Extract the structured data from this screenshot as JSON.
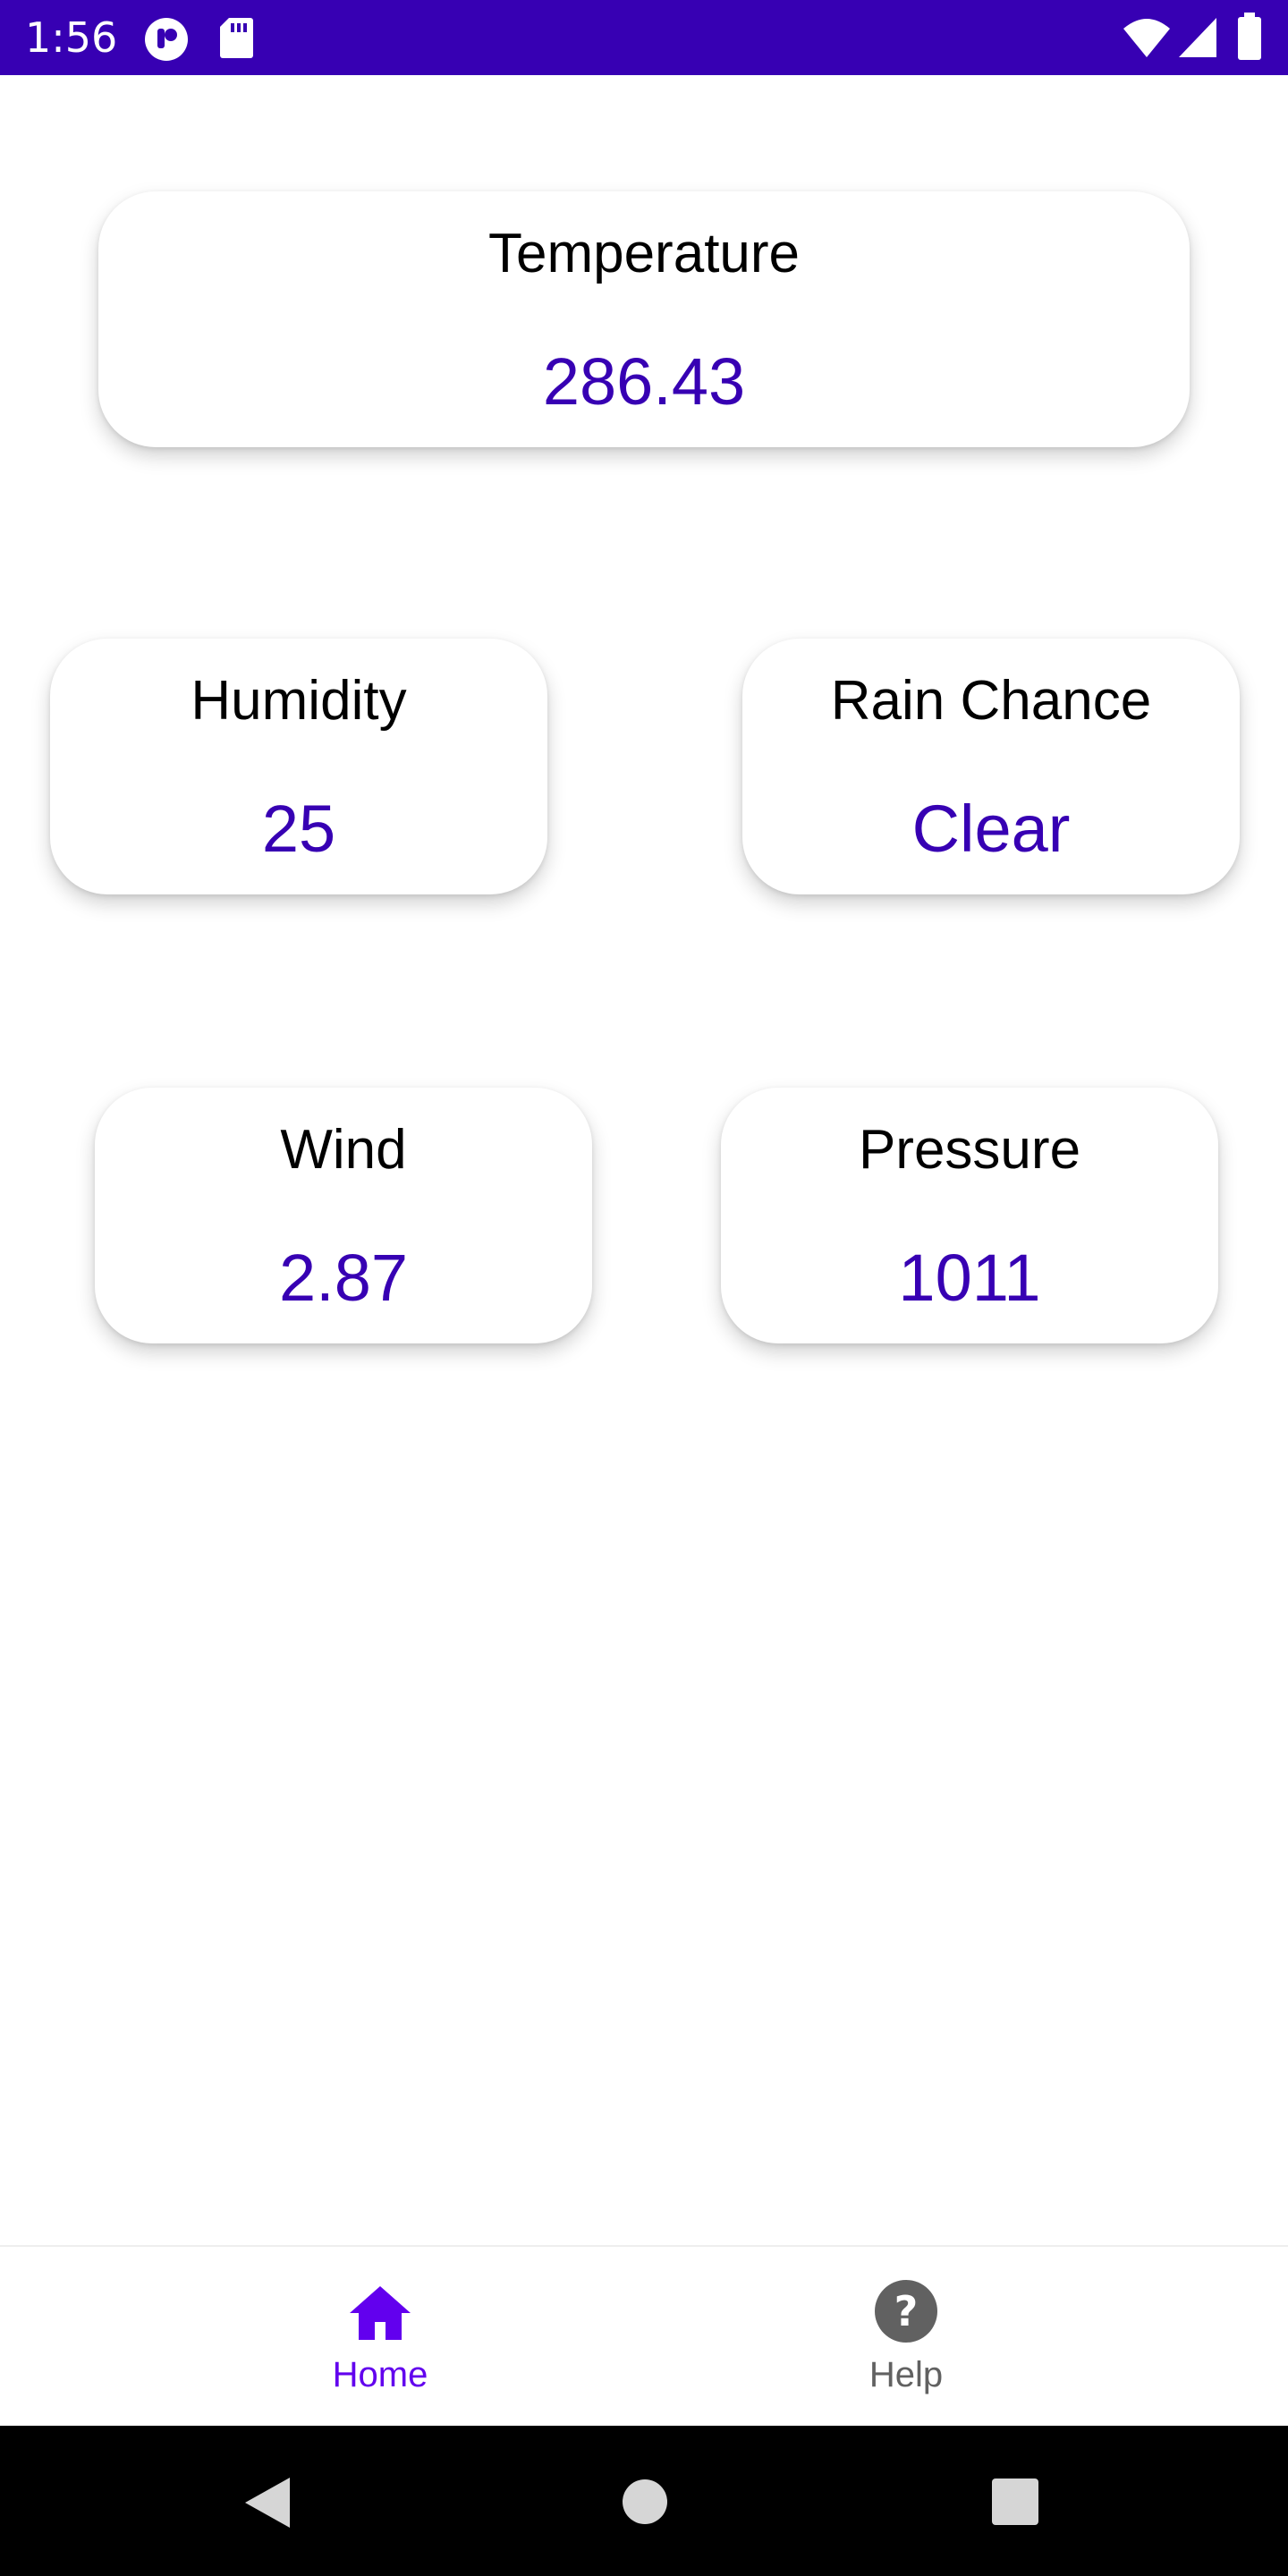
{
  "status_bar": {
    "time": "1:56",
    "background": "#3700b3",
    "icons": [
      "notification-app-icon",
      "sd-card-icon",
      "wifi-icon",
      "signal-icon",
      "battery-icon"
    ]
  },
  "cards": {
    "temperature": {
      "label": "Temperature",
      "value": "286.43"
    },
    "humidity": {
      "label": "Humidity",
      "value": "25"
    },
    "rain_chance": {
      "label": "Rain Chance",
      "value": "Clear"
    },
    "wind": {
      "label": "Wind",
      "value": "2.87"
    },
    "pressure": {
      "label": "Pressure",
      "value": "1011"
    }
  },
  "colors": {
    "accent": "#3700b3",
    "active_nav": "#6200ee",
    "inactive_nav": "#616161"
  },
  "bottom_nav": {
    "items": [
      {
        "label": "Home",
        "icon": "home-icon",
        "active": true
      },
      {
        "label": "Help",
        "icon": "help-icon",
        "active": false
      }
    ]
  },
  "system_nav": {
    "buttons": [
      "back-icon",
      "home-circle-icon",
      "recents-icon"
    ]
  }
}
